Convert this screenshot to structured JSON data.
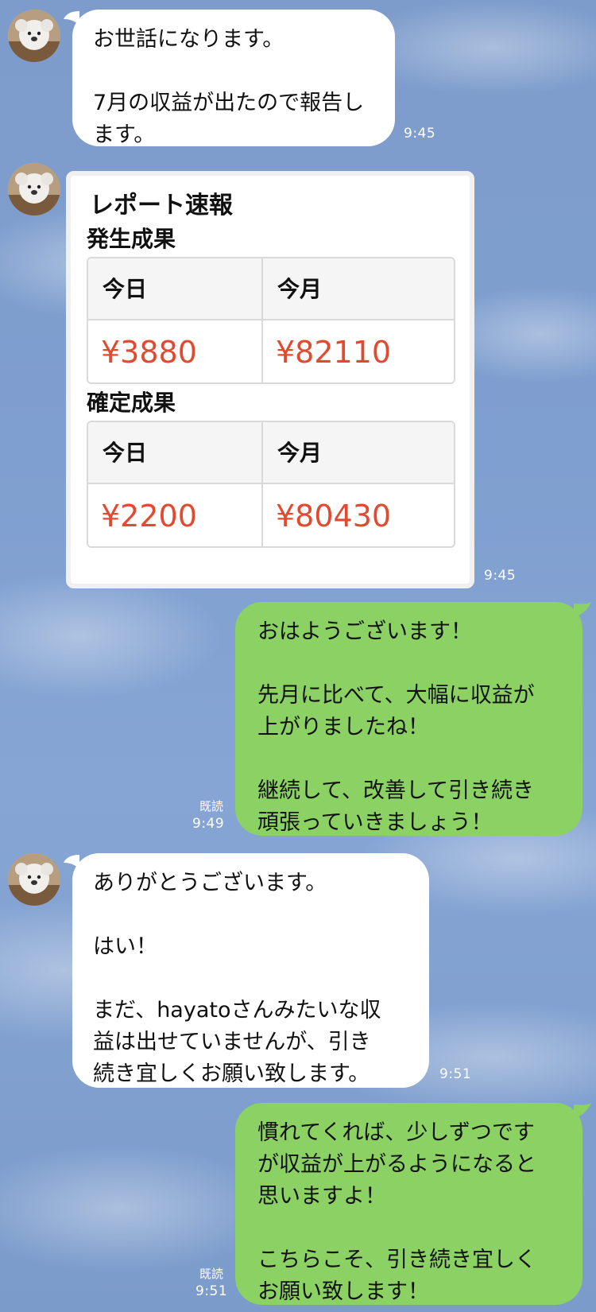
{
  "messages": [
    {
      "side": "in",
      "text": "お世話になります。\n\n7月の収益が出たので報告し\nます。",
      "time": "9:45"
    },
    {
      "side": "in",
      "type": "report_card",
      "time": "9:45",
      "card": {
        "title": "レポート速報",
        "sections": [
          {
            "title": "発生成果",
            "headers": [
              "今日",
              "今月"
            ],
            "values": [
              "¥3880",
              "¥82110"
            ]
          },
          {
            "title": "確定成果",
            "headers": [
              "今日",
              "今月"
            ],
            "values": [
              "¥2200",
              "¥80430"
            ]
          }
        ]
      }
    },
    {
      "side": "out",
      "text": "おはようございます！\n\n先月に比べて、大幅に収益が\n上がりましたね！\n\n継続して、改善して引き続き\n頑張っていきましょう！",
      "read": "既読",
      "time": "9:49"
    },
    {
      "side": "in",
      "text": "ありがとうございます。\n\nはい！\n\nまだ、hayatoさんみたいな収\n益は出せていませんが、引き\n続き宜しくお願い致します。",
      "time": "9:51"
    },
    {
      "side": "out",
      "text": "慣れてくれば、少しずつです\nが収益が上がるようになると\n思いますよ！\n\nこちらこそ、引き続き宜しく\nお願い致します！",
      "read": "既読",
      "time": "9:51"
    }
  ],
  "colors": {
    "incoming_bubble": "#ffffff",
    "outgoing_bubble": "#8bd163",
    "report_value": "#e24a30",
    "background": "#7f9fd0"
  },
  "icons": {
    "avatar": "koala-avatar-icon"
  }
}
